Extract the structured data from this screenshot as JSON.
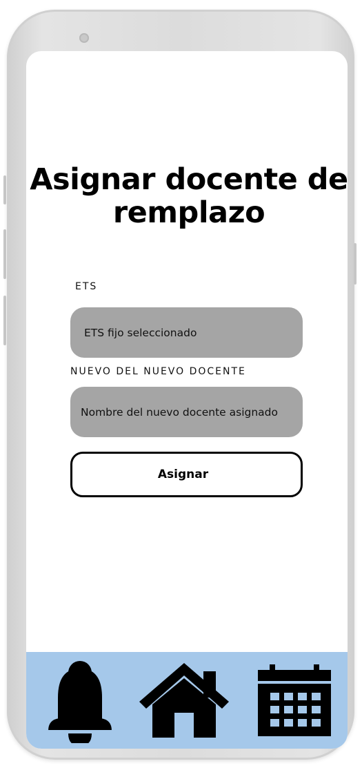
{
  "screen": {
    "title": "Asignar docente de remplazo"
  },
  "form": {
    "ets_label": "ETS",
    "ets_value": "ETS fijo seleccionado",
    "docente_label": "NUEVO DEL NUEVO DOCENTE",
    "docente_value": "Nombre del nuevo docente asignado",
    "assign_label": "Asignar"
  },
  "bottom_nav": {
    "background": "#a5c8ea",
    "items": [
      {
        "icon": "bell-icon"
      },
      {
        "icon": "home-icon"
      },
      {
        "icon": "calendar-icon"
      }
    ]
  }
}
